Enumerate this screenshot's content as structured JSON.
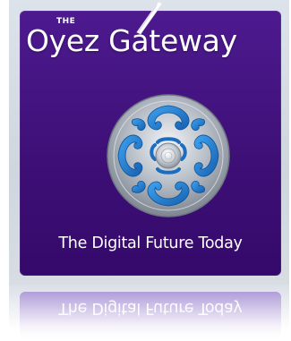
{
  "logo": {
    "the_label": "THE",
    "title": "Oyez Gateway",
    "tagline": "The Digital Future Today",
    "emblem_icon": "spiral-medallion-icon",
    "quill_icon": "quill-icon"
  },
  "colors": {
    "card_background": "#3e1077",
    "frame_background": "#d5dbe2",
    "text": "#ffffff",
    "emblem_blue": "#1f7fd0",
    "emblem_silver": "#b8bec6"
  }
}
